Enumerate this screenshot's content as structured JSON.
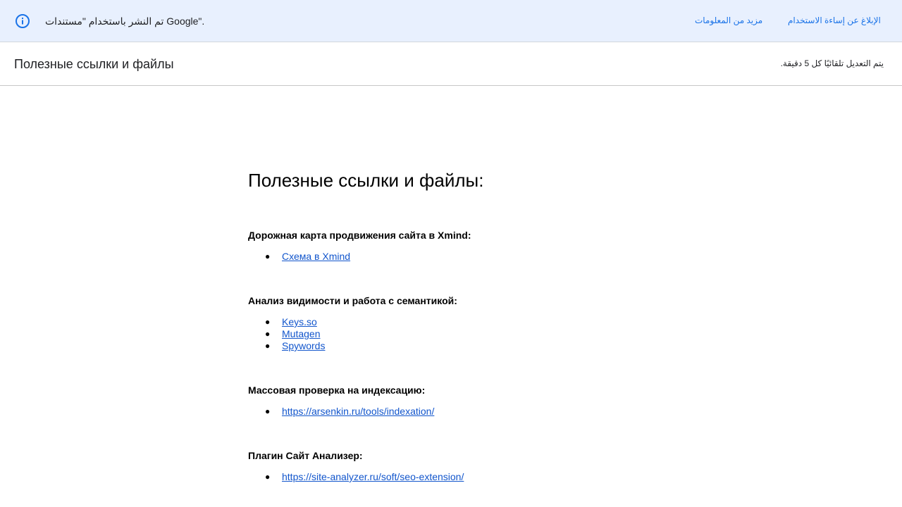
{
  "banner": {
    "text": "تم النشر باستخدام \"مستندات Google\".",
    "report_link": "الإبلاغ عن إساءة الاستخدام",
    "more_link": "مزيد من المعلومات"
  },
  "header": {
    "title": "Полезные ссылки и файлы",
    "update_note": "يتم التعديل تلقائيًا كل 5 دقيقة."
  },
  "document": {
    "heading": "Полезные ссылки и файлы:",
    "bullet": "●",
    "sections": [
      {
        "title": "Дорожная карта продвижения сайта в Xmind:",
        "links": [
          "Схема в Xmind"
        ]
      },
      {
        "title": "Анализ видимости и работа с семантикой:",
        "links": [
          "Keys.so",
          "Mutagen",
          "Spywords"
        ]
      },
      {
        "title": "Массовая проверка на индексацию:",
        "links": [
          "https://arsenkin.ru/tools/indexation/"
        ]
      },
      {
        "title": "Плагин Сайт Анализер:",
        "links": [
          "https://site-analyzer.ru/soft/seo-extension/"
        ]
      }
    ]
  },
  "colors": {
    "banner_bg": "#e8f0fe",
    "link_blue": "#1a73e8",
    "doc_link": "#1155cc"
  },
  "icons": {
    "banner_icon": "info-icon"
  }
}
